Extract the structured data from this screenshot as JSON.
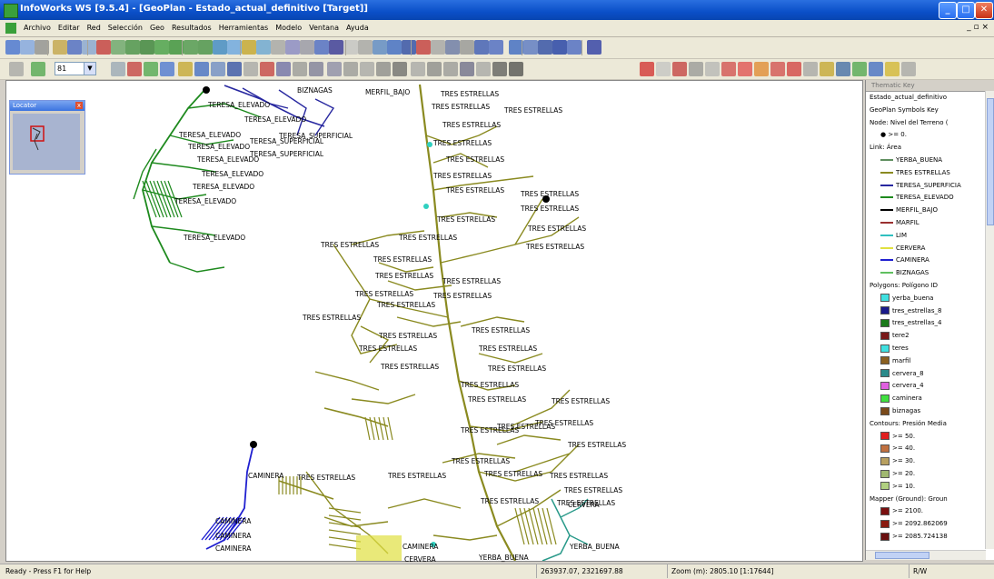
{
  "window": {
    "title": "InfoWorks WS [9.5.4] - [GeoPlan - Estado_actual_definitivo [Target]]",
    "min_label": "_",
    "max_label": "□",
    "close_label": "✕"
  },
  "menu": {
    "items": [
      "Archivo",
      "Editar",
      "Red",
      "Selección",
      "Geo",
      "Resultados",
      "Herramientas",
      "Modelo",
      "Ventana",
      "Ayuda"
    ],
    "mdi_controls": "_ ▫ ×"
  },
  "toolbar2": {
    "combo_value": "81"
  },
  "locator": {
    "title": "Locator",
    "close_label": "x"
  },
  "map": {
    "labels": [
      {
        "text": "BIZNAGAS"
      },
      {
        "text": "MERFIL_BAJO"
      },
      {
        "text": "TERESA_ELEVADO"
      },
      {
        "text": "TERESA_ELEVADO"
      },
      {
        "text": "TERESA_ELEVADO"
      },
      {
        "text": "TERESA_ELEVADO"
      },
      {
        "text": "TERESA_ELEVADO"
      },
      {
        "text": "TERESA_ELEVADO"
      },
      {
        "text": "TERESA_ELEVADO"
      },
      {
        "text": "TERESA_ELEVADO"
      },
      {
        "text": "TERESA_ELEVADO"
      },
      {
        "text": "TERESA_SUPERFICIAL"
      },
      {
        "text": "TERESA_SUPERFICIAL"
      },
      {
        "text": "TERESA_SUPERFICIAL"
      },
      {
        "text": "TRES ESTRELLAS"
      },
      {
        "text": "TRES ESTRELLAS"
      },
      {
        "text": "TRES ESTRELLAS"
      },
      {
        "text": "TRES ESTRELLAS"
      },
      {
        "text": "TRES ESTRELLAS"
      },
      {
        "text": "TRES ESTRELLAS"
      },
      {
        "text": "TRES ESTRELLAS"
      },
      {
        "text": "TRES ESTRELLAS"
      },
      {
        "text": "TRES ESTRELLAS"
      },
      {
        "text": "TRES ESTRELLAS"
      },
      {
        "text": "TRES ESTRELLAS"
      },
      {
        "text": "TRES ESTRELLAS"
      },
      {
        "text": "TRES ESTRELLAS"
      },
      {
        "text": "TRES ESTRELLAS"
      },
      {
        "text": "TRES ESTRELLAS"
      },
      {
        "text": "TRES ESTRELLAS"
      },
      {
        "text": "TRES ESTRELLAS"
      },
      {
        "text": "TRES ESTRELLAS"
      },
      {
        "text": "TRES ESTRELLAS"
      },
      {
        "text": "TRES ESTRELLAS"
      },
      {
        "text": "TRES ESTRELLAS"
      },
      {
        "text": "TRES ESTRELLAS"
      },
      {
        "text": "TRES ESTRELLAS"
      },
      {
        "text": "TRES ESTRELLAS"
      },
      {
        "text": "TRES ESTRELLAS"
      },
      {
        "text": "TRES ESTRELLAS"
      },
      {
        "text": "TRES ESTRELLAS"
      },
      {
        "text": "TRES ESTRELLAS"
      },
      {
        "text": "TRES ESTRELLAS"
      },
      {
        "text": "TRES ESTRELLAS"
      },
      {
        "text": "TRES ESTRELLAS"
      },
      {
        "text": "TRES ESTRELLAS"
      },
      {
        "text": "TRES ESTRELLAS"
      },
      {
        "text": "TRES ESTRELLAS"
      },
      {
        "text": "TRES ESTRELLAS"
      },
      {
        "text": "TRES ESTRELLAS"
      },
      {
        "text": "TRES ESTRELLAS"
      },
      {
        "text": "TRES ESTRELLAS"
      },
      {
        "text": "TRES ESTRELLAS"
      },
      {
        "text": "TRES ESTRELLAS"
      },
      {
        "text": "TRES ESTRELLAS"
      },
      {
        "text": "TRES ESTRELLAS"
      },
      {
        "text": "CAMINERA"
      },
      {
        "text": "CAMINERA"
      },
      {
        "text": "CAMINERA"
      },
      {
        "text": "CAMINERA"
      },
      {
        "text": "CAMINERA"
      },
      {
        "text": "CERVERA"
      },
      {
        "text": "CERVERA"
      },
      {
        "text": "YERBA_BUENA"
      },
      {
        "text": "YERBA_BUENA"
      },
      {
        "text": "TRES ESTRELLAS"
      },
      {
        "text": "TRES ESTRELLAS"
      },
      {
        "text": "TRES ESTRELLAS"
      }
    ]
  },
  "key": {
    "header": "Thematic Key",
    "rows": [
      {
        "text": "Estado_actual_definitivo",
        "kind": "text"
      },
      {
        "text": "GeoPlan Symbols Key",
        "kind": "text"
      },
      {
        "text": "Node: Nivel del Terreno (",
        "kind": "text"
      },
      {
        "text": ">= 0.",
        "kind": "dot"
      },
      {
        "text": "Link: Área",
        "kind": "text"
      },
      {
        "text": "YERBA_BUENA",
        "kind": "line",
        "color": "#5f8f5f"
      },
      {
        "text": "TRES ESTRELLAS",
        "kind": "line",
        "color": "#8a8a20"
      },
      {
        "text": "TERESA_SUPERFICIA",
        "kind": "line",
        "color": "#2828a0"
      },
      {
        "text": "TERESA_ELEVADO",
        "kind": "line",
        "color": "#1e8a1e"
      },
      {
        "text": "MERFIL_BAJO",
        "kind": "line",
        "color": "#000000"
      },
      {
        "text": "MARFIL",
        "kind": "line",
        "color": "#9a3030"
      },
      {
        "text": "LIM",
        "kind": "line",
        "color": "#30c0c0"
      },
      {
        "text": "CERVERA",
        "kind": "line",
        "color": "#e0e040"
      },
      {
        "text": "CAMINERA",
        "kind": "line",
        "color": "#2020d0"
      },
      {
        "text": "BIZNAGAS",
        "kind": "line",
        "color": "#60c060"
      },
      {
        "text": "Polygons: Polígono ID",
        "kind": "text"
      },
      {
        "text": "yerba_buena",
        "kind": "swatch",
        "color": "#40e0e0"
      },
      {
        "text": "tres_estrellas_8",
        "kind": "swatch",
        "color": "#1a1a8a"
      },
      {
        "text": "tres_estrellas_4",
        "kind": "swatch",
        "color": "#1a7a1a"
      },
      {
        "text": "tere2",
        "kind": "swatch",
        "color": "#7a1a1a"
      },
      {
        "text": "teres",
        "kind": "swatch",
        "color": "#40e0e0"
      },
      {
        "text": "marfil",
        "kind": "swatch",
        "color": "#8a6020"
      },
      {
        "text": "cervera_8",
        "kind": "swatch",
        "color": "#2a8a8a"
      },
      {
        "text": "cervera_4",
        "kind": "swatch",
        "color": "#e060e0"
      },
      {
        "text": "caminera",
        "kind": "swatch",
        "color": "#40e040"
      },
      {
        "text": "biznagas",
        "kind": "swatch",
        "color": "#7a4a1a"
      },
      {
        "text": "Contours: Presión Media",
        "kind": "text"
      },
      {
        "text": ">= 50.",
        "kind": "swatch",
        "color": "#e02020"
      },
      {
        "text": ">= 40.",
        "kind": "swatch",
        "color": "#c07040"
      },
      {
        "text": ">= 30.",
        "kind": "swatch",
        "color": "#b8a060"
      },
      {
        "text": ">= 20.",
        "kind": "swatch",
        "color": "#a0b870"
      },
      {
        "text": ">= 10.",
        "kind": "swatch",
        "color": "#b0d080"
      },
      {
        "text": "Mapper (Ground): Groun",
        "kind": "text"
      },
      {
        "text": ">= 2100.",
        "kind": "swatch",
        "color": "#7a1010"
      },
      {
        "text": ">= 2092.862069",
        "kind": "swatch",
        "color": "#8a1a10"
      },
      {
        "text": ">= 2085.724138",
        "kind": "swatch",
        "color": "#6a1010"
      }
    ]
  },
  "status": {
    "help": "Ready - Press F1 for Help",
    "coords": "263937.07, 2321697.88",
    "zoom": "Zoom (m): 2805.10 [1:17644]",
    "mode": "R/W"
  },
  "colors": {
    "tres_estrellas": "#8a8a20",
    "teresa_elevado": "#1e8a1e",
    "teresa_superficial": "#2828a0",
    "caminera": "#2020d0",
    "cervera": "#e0e040",
    "yerba_buena": "#2a9a8a"
  }
}
